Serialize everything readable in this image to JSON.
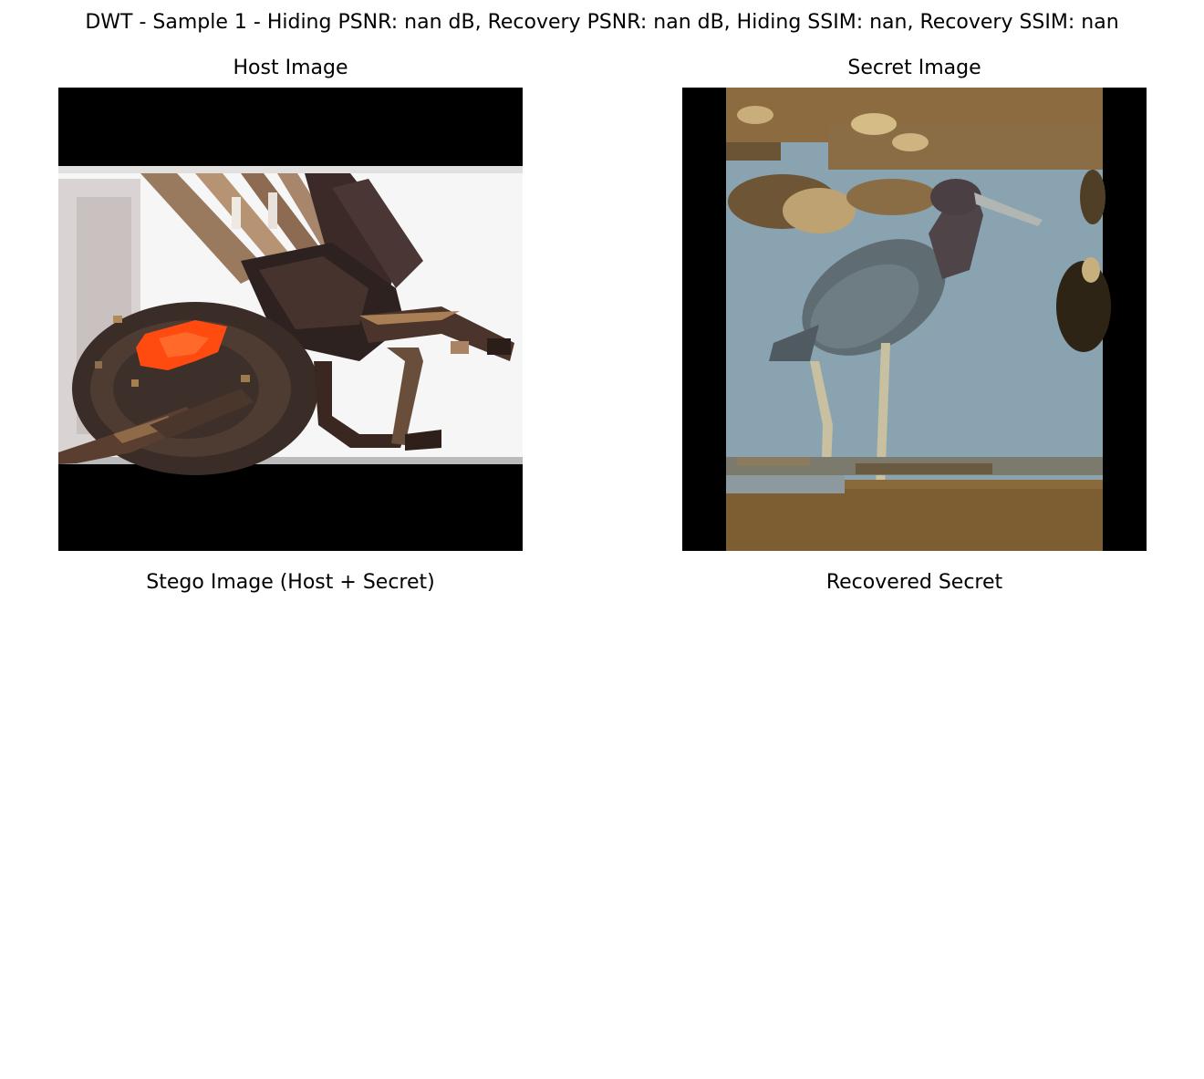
{
  "figure": {
    "title": "DWT - Sample 1 - Hiding PSNR: nan dB, Recovery PSNR: nan dB, Hiding SSIM: nan, Recovery SSIM: nan"
  },
  "panels": {
    "host": {
      "title": "Host Image",
      "content_icon": "spider-photo-icon"
    },
    "secret": {
      "title": "Secret Image",
      "content_icon": "heron-photo-icon"
    },
    "stego": {
      "title": "Stego Image (Host + Secret)"
    },
    "recovered": {
      "title": "Recovered Secret"
    }
  },
  "colors": {
    "background": "#ffffff",
    "letterbox": "#000000",
    "water": "#8aa3b0",
    "mud": "#8a6a3a",
    "accent_red": "#ff4a10"
  }
}
